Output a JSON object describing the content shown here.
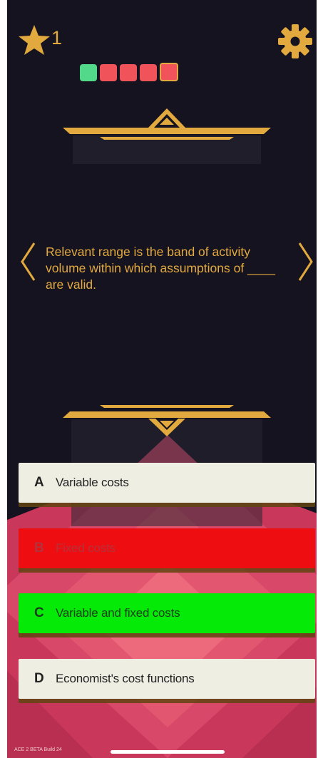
{
  "hud": {
    "star_count": "1",
    "star_icon": "star-icon",
    "settings_icon": "gear-icon",
    "progress": [
      "correct",
      "wrong",
      "wrong",
      "wrong",
      "current"
    ]
  },
  "colors": {
    "background": "#15131f",
    "gold": "#e2a93e",
    "pip_correct": "#52d98a",
    "pip_wrong": "#f0545a",
    "answer_default": "#efeee3",
    "answer_wrong": "#ee0d10",
    "answer_correct": "#06ea08",
    "pink_bg": "#d3425f"
  },
  "question": {
    "text": "Relevant range is the band of activity volume within which assumptions of ____ are valid."
  },
  "answers": [
    {
      "letter": "A",
      "text": "Variable costs",
      "state": "default"
    },
    {
      "letter": "B",
      "text": "Fixed costs",
      "state": "wrong"
    },
    {
      "letter": "C",
      "text": "Variable and fixed costs",
      "state": "correct"
    },
    {
      "letter": "D",
      "text": "Economist's cost functions",
      "state": "default"
    }
  ],
  "footer": {
    "build": "ACE 2 BETA Build 24"
  }
}
